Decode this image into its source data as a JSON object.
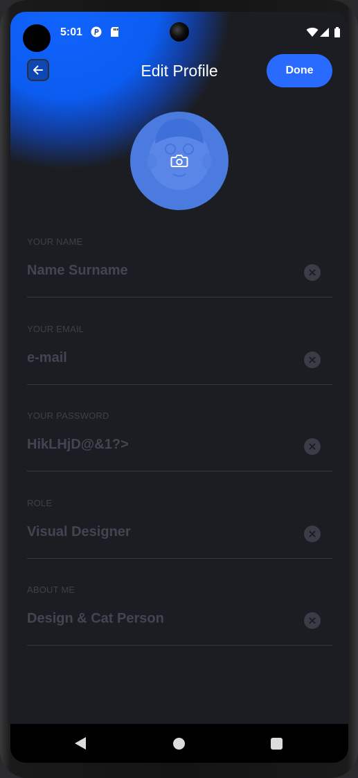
{
  "status_bar": {
    "time": "5:01"
  },
  "header": {
    "title": "Edit Profile",
    "done_label": "Done"
  },
  "colors": {
    "accent": "#2a6bff",
    "background": "#1c1d22",
    "avatar": "#4c7bdf",
    "label": "#3d404c",
    "value": "#424552"
  },
  "form": {
    "fields": [
      {
        "label": "YOUR NAME",
        "value": "Name Surname"
      },
      {
        "label": "YOUR EMAIL",
        "value": "e-mail"
      },
      {
        "label": "YOUR PASSWORD",
        "value": "HikLHjD@&1?>"
      },
      {
        "label": "ROLE",
        "value": "Visual Designer"
      },
      {
        "label": "ABOUT ME",
        "value": "Design & Cat Person"
      }
    ]
  },
  "icons": {
    "back": "arrow-left-icon",
    "camera": "camera-icon",
    "clear": "close-circle-icon"
  }
}
